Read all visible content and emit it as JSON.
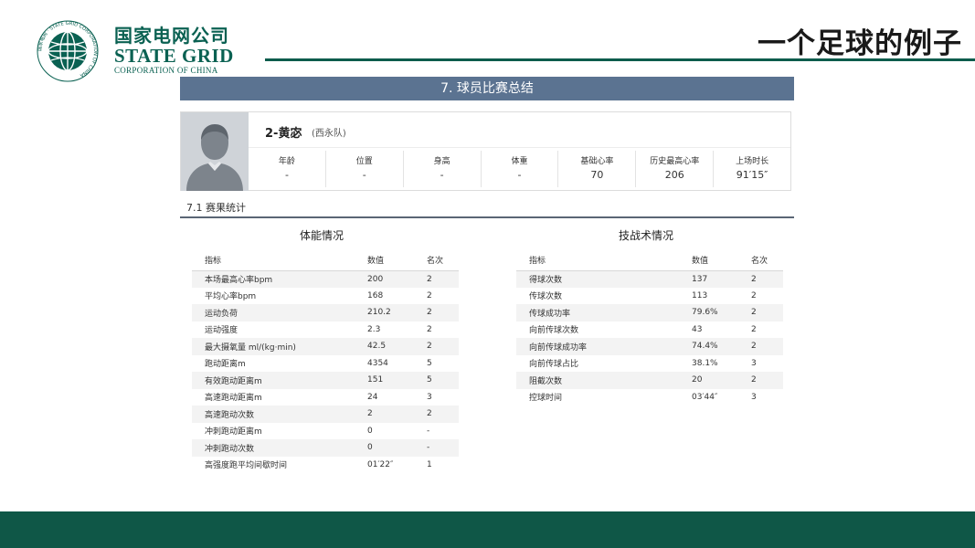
{
  "brand": {
    "name_cn": "国家电网公司",
    "name_en": "STATE GRID",
    "name_en_sub": "CORPORATION OF CHINA",
    "ring_text": "国家电网 · STATE GRID CORPORATION OF CHINA",
    "color": "#0a6152"
  },
  "slide_title": "一个足球的例子",
  "report": {
    "header": "7. 球员比赛总结",
    "player": {
      "name": "2-黄宓",
      "team": "(西永队)",
      "stats": [
        {
          "label": "年龄",
          "value": "-"
        },
        {
          "label": "位置",
          "value": "-"
        },
        {
          "label": "身高",
          "value": "-"
        },
        {
          "label": "体重",
          "value": "-"
        },
        {
          "label": "基础心率",
          "value": "70"
        },
        {
          "label": "历史最高心率",
          "value": "206"
        },
        {
          "label": "上场时长",
          "value": "91′15″"
        }
      ]
    },
    "section_title": "7.1 赛果统计",
    "physical": {
      "caption": "体能情况",
      "headers": [
        "指标",
        "数值",
        "名次"
      ],
      "rows": [
        [
          "本场最高心率bpm",
          "200",
          "2"
        ],
        [
          "平均心率bpm",
          "168",
          "2"
        ],
        [
          "运动负荷",
          "210.2",
          "2"
        ],
        [
          "运动强度",
          "2.3",
          "2"
        ],
        [
          "最大摄氧量 ml/(kg·min)",
          "42.5",
          "2"
        ],
        [
          "跑动距离m",
          "4354",
          "5"
        ],
        [
          "有效跑动距离m",
          "151",
          "5"
        ],
        [
          "高速跑动距离m",
          "24",
          "3"
        ],
        [
          "高速跑动次数",
          "2",
          "2"
        ],
        [
          "冲刺跑动距离m",
          "0",
          "-"
        ],
        [
          "冲刺跑动次数",
          "0",
          "-"
        ],
        [
          "高强度跑平均间歇时间",
          "01′22″",
          "1"
        ]
      ]
    },
    "technical": {
      "caption": "技战术情况",
      "headers": [
        "指标",
        "数值",
        "名次"
      ],
      "rows": [
        [
          "得球次数",
          "137",
          "2"
        ],
        [
          "传球次数",
          "113",
          "2"
        ],
        [
          "传球成功率",
          "79.6%",
          "2"
        ],
        [
          "向前传球次数",
          "43",
          "2"
        ],
        [
          "向前传球成功率",
          "74.4%",
          "2"
        ],
        [
          "向前传球占比",
          "38.1%",
          "3"
        ],
        [
          "阻截次数",
          "20",
          "2"
        ],
        [
          "控球时间",
          "03′44″",
          "3"
        ]
      ]
    }
  },
  "colors": {
    "report_header": "#5b7391",
    "footer": "#0f5747",
    "accent_rule": "#0d5c4c"
  }
}
